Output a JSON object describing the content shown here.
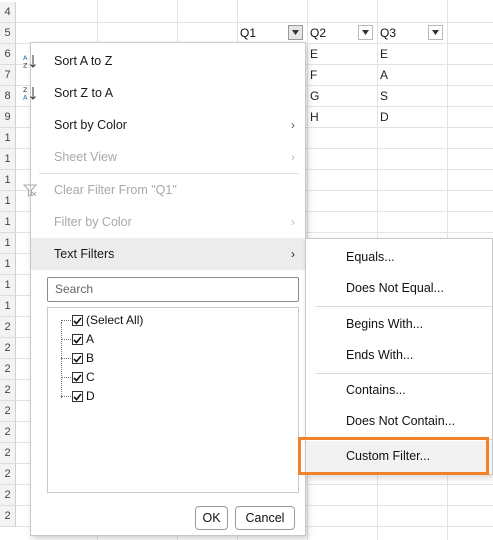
{
  "sheet": {
    "row_numbers": [
      "4",
      "5",
      "6",
      "7",
      "8",
      "9",
      "1",
      "1",
      "1",
      "1",
      "1",
      "1",
      "1",
      "1",
      "1",
      "2",
      "2",
      "2",
      "2",
      "2",
      "2",
      "2",
      "2",
      "2",
      "2"
    ],
    "headers": [
      {
        "label": "Q1"
      },
      {
        "label": "Q2"
      },
      {
        "label": "Q3"
      }
    ],
    "columns": {
      "q2": [
        "E",
        "F",
        "G",
        "H"
      ],
      "q3": [
        "E",
        "A",
        "S",
        "D"
      ]
    }
  },
  "filter_menu": {
    "sort_a_z": "Sort A to Z",
    "sort_z_a": "Sort Z to A",
    "sort_by_color": "Sort by Color",
    "sheet_view": "Sheet View",
    "clear_filter": "Clear Filter From \"Q1\"",
    "filter_by_color": "Filter by Color",
    "text_filters": "Text Filters",
    "search_placeholder": "Search",
    "items": [
      {
        "label": "(Select All)",
        "checked": true
      },
      {
        "label": "A",
        "checked": true
      },
      {
        "label": "B",
        "checked": true
      },
      {
        "label": "C",
        "checked": true
      },
      {
        "label": "D",
        "checked": true
      }
    ],
    "ok": "OK",
    "cancel": "Cancel"
  },
  "text_filters_submenu": {
    "items": [
      "Equals...",
      "Does Not Equal...",
      "Begins With...",
      "Ends With...",
      "Contains...",
      "Does Not Contain...",
      "Custom Filter..."
    ],
    "highlighted": "Custom Filter..."
  },
  "colors": {
    "highlight_border": "#f0822a",
    "hover_bg": "#ececec",
    "disabled_text": "#a8a8a8"
  }
}
